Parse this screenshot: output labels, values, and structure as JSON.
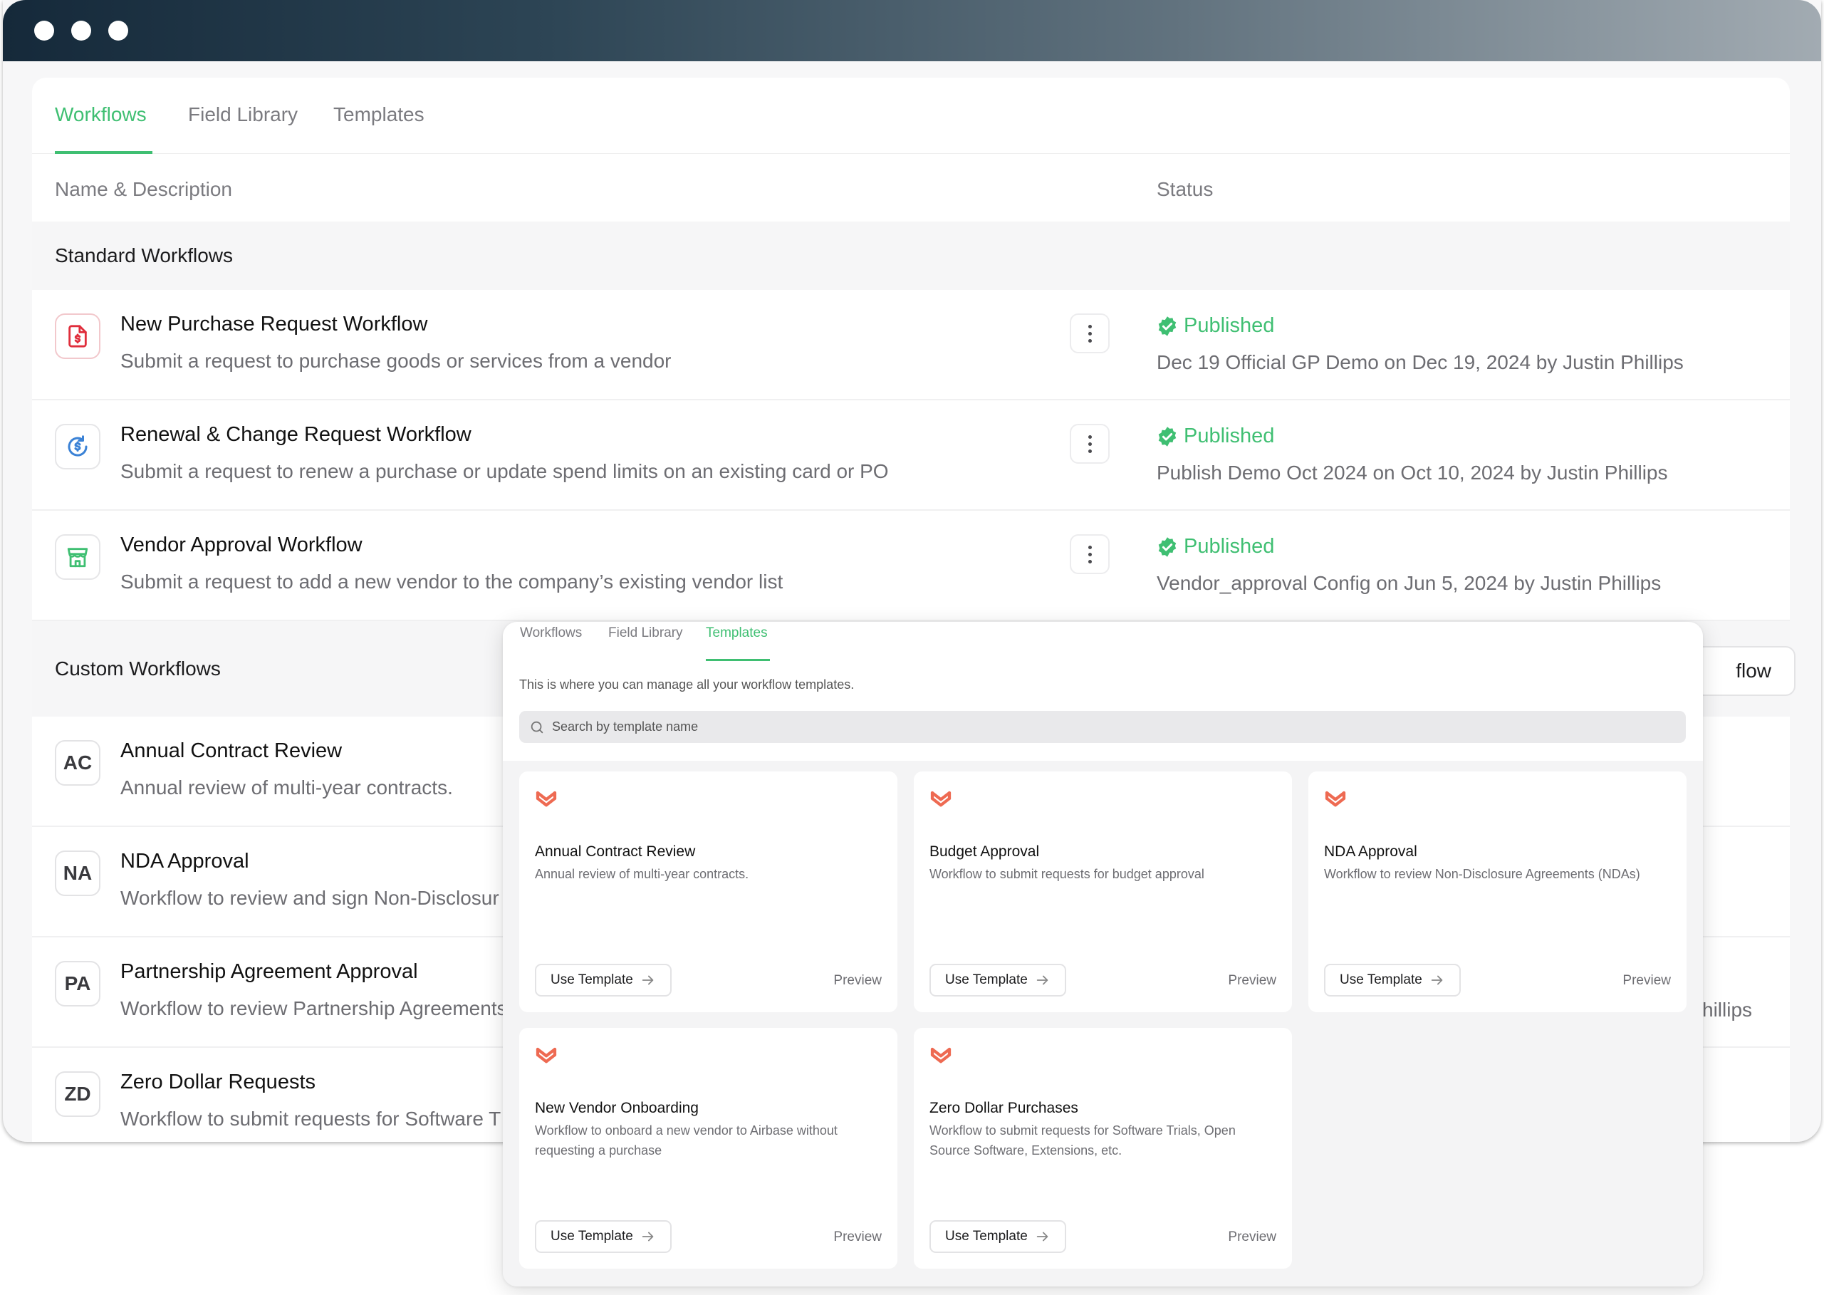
{
  "colors": {
    "accent": "#3fbf72",
    "brand_logo": "#ee6a52",
    "danger_icon": "#e02e3c",
    "blue_icon": "#3b82d6"
  },
  "main": {
    "tabs": [
      {
        "label": "Workflows",
        "active": true
      },
      {
        "label": "Field Library",
        "active": false
      },
      {
        "label": "Templates",
        "active": false
      }
    ],
    "columns": {
      "name": "Name & Description",
      "status": "Status"
    },
    "standard_section": "Standard Workflows",
    "standard_workflows": [
      {
        "icon": "dollar-document-icon",
        "title": "New Purchase Request Workflow",
        "description": "Submit a request to purchase goods or services from a vendor",
        "status": "Published",
        "meta": "Dec 19 Official GP Demo on Dec 19, 2024 by Justin Phillips"
      },
      {
        "icon": "dollar-refresh-icon",
        "title": "Renewal & Change Request Workflow",
        "description": "Submit a request to renew a purchase or update spend limits on an existing card or PO",
        "status": "Published",
        "meta": "Publish Demo Oct 2024 on Oct 10, 2024 by Justin Phillips"
      },
      {
        "icon": "storefront-icon",
        "title": "Vendor Approval Workflow",
        "description": "Submit a request to add a new vendor to the company’s existing vendor list",
        "status": "Published",
        "meta": "Vendor_approval Config on Jun 5, 2024 by Justin Phillips"
      }
    ],
    "custom_section": "Custom Workflows",
    "new_button_partial": "flow",
    "custom_workflows": [
      {
        "initials": "AC",
        "title": "Annual Contract Review",
        "description": "Annual review of multi-year contracts."
      },
      {
        "initials": "NA",
        "title": "NDA Approval",
        "description": "Workflow to review and sign Non-Disclosur"
      },
      {
        "initials": "PA",
        "title": "Partnership Agreement Approval",
        "description": "Workflow to review Partnership Agreements",
        "meta_partial": "hillips"
      },
      {
        "initials": "ZD",
        "title": "Zero Dollar Requests",
        "description": "Workflow to submit requests for Software T"
      }
    ]
  },
  "templates_view": {
    "tabs": [
      {
        "label": "Workflows",
        "active": false
      },
      {
        "label": "Field Library",
        "active": false
      },
      {
        "label": "Templates",
        "active": true
      }
    ],
    "description": "This is where you can manage all your workflow templates.",
    "search_placeholder": "Search by template name",
    "use_label": "Use Template",
    "preview_label": "Preview",
    "templates": [
      {
        "title": "Annual Contract Review",
        "description": "Annual review of multi-year contracts."
      },
      {
        "title": "Budget Approval",
        "description": "Workflow to submit requests for budget approval"
      },
      {
        "title": "NDA Approval",
        "description": "Workflow to review Non-Disclosure Agreements (NDAs)"
      },
      {
        "title": "New Vendor Onboarding",
        "description": "Workflow to onboard a new vendor to Airbase without requesting a purchase"
      },
      {
        "title": "Zero Dollar Purchases",
        "description": "Workflow to submit requests for Software Trials, Open Source Software, Extensions, etc."
      }
    ]
  }
}
